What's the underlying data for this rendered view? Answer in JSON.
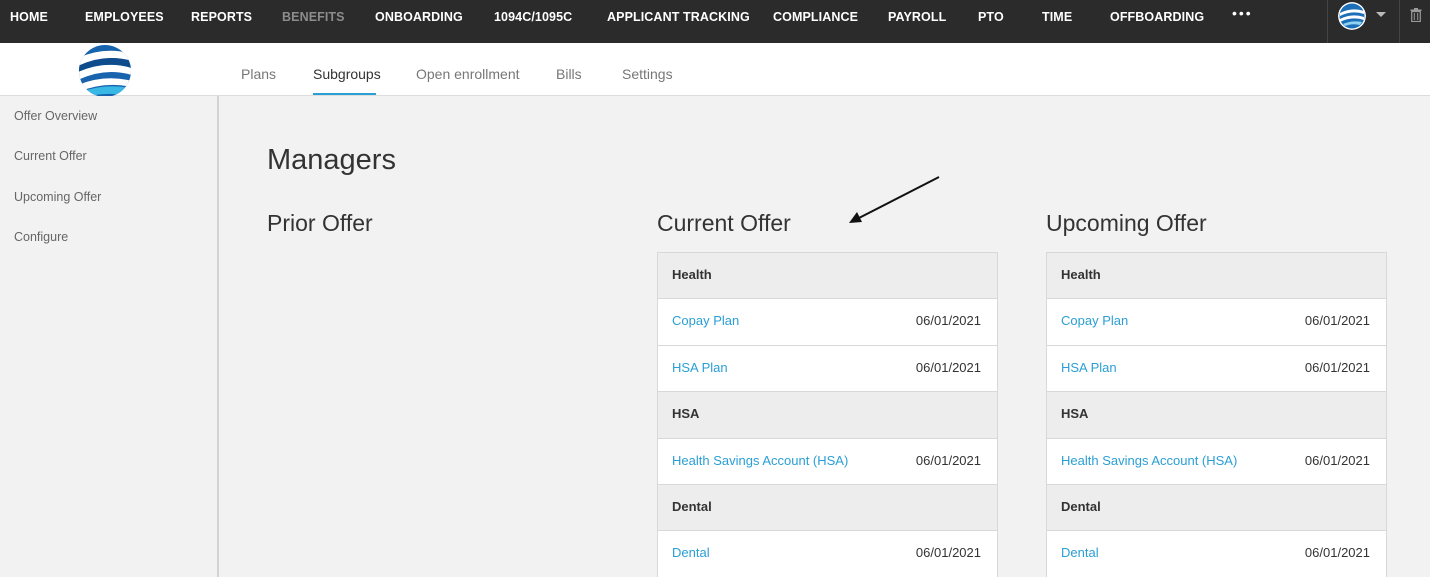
{
  "topnav": {
    "items": [
      {
        "label": "HOME",
        "dim": false
      },
      {
        "label": "EMPLOYEES",
        "dim": false
      },
      {
        "label": "REPORTS",
        "dim": false
      },
      {
        "label": "BENEFITS",
        "dim": true
      },
      {
        "label": "ONBOARDING",
        "dim": false
      },
      {
        "label": "1094C/1095C",
        "dim": false
      },
      {
        "label": "APPLICANT TRACKING",
        "dim": false
      },
      {
        "label": "COMPLIANCE",
        "dim": false
      },
      {
        "label": "PAYROLL",
        "dim": false
      },
      {
        "label": "PTO",
        "dim": false
      },
      {
        "label": "TIME",
        "dim": false
      },
      {
        "label": "OFFBOARDING",
        "dim": false
      }
    ],
    "more": "•••",
    "icons": [
      "avatar",
      "chevron-down-icon",
      "trash-icon"
    ]
  },
  "tabs": {
    "items": [
      {
        "label": "Plans",
        "active": false
      },
      {
        "label": "Subgroups",
        "active": true
      },
      {
        "label": "Open enrollment",
        "active": false
      },
      {
        "label": "Bills",
        "active": false
      },
      {
        "label": "Settings",
        "active": false
      }
    ],
    "accent": "#2a9fd6"
  },
  "sidebar": {
    "items": [
      {
        "label": "Offer Overview"
      },
      {
        "label": "Current Offer"
      },
      {
        "label": "Upcoming Offer"
      },
      {
        "label": "Configure"
      }
    ]
  },
  "main": {
    "title": "Managers",
    "columns": [
      {
        "title": "Prior Offer",
        "rows": []
      },
      {
        "title": "Current Offer",
        "rows": [
          {
            "type": "section",
            "label": "Health"
          },
          {
            "type": "plan",
            "label": "Copay Plan",
            "date": "06/01/2021"
          },
          {
            "type": "plan",
            "label": "HSA Plan",
            "date": "06/01/2021"
          },
          {
            "type": "section",
            "label": "HSA"
          },
          {
            "type": "plan",
            "label": "Health Savings Account (HSA)",
            "date": "06/01/2021"
          },
          {
            "type": "section",
            "label": "Dental"
          },
          {
            "type": "plan",
            "label": "Dental",
            "date": "06/01/2021"
          }
        ]
      },
      {
        "title": "Upcoming Offer",
        "rows": [
          {
            "type": "section",
            "label": "Health"
          },
          {
            "type": "plan",
            "label": "Copay Plan",
            "date": "06/01/2021"
          },
          {
            "type": "plan",
            "label": "HSA Plan",
            "date": "06/01/2021"
          },
          {
            "type": "section",
            "label": "HSA"
          },
          {
            "type": "plan",
            "label": "Health Savings Account (HSA)",
            "date": "06/01/2021"
          },
          {
            "type": "section",
            "label": "Dental"
          },
          {
            "type": "plan",
            "label": "Dental",
            "date": "06/01/2021"
          }
        ]
      }
    ]
  },
  "colors": {
    "link": "#2a9fd6",
    "nav_bg": "#2b2b2b",
    "page_bg": "#f2f2f2"
  }
}
